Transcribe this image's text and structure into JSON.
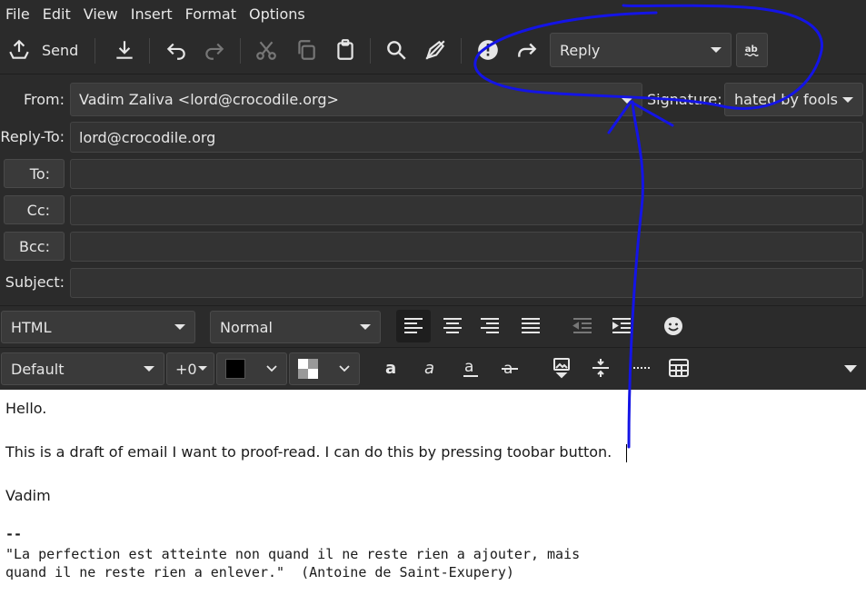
{
  "menu": [
    "File",
    "Edit",
    "View",
    "Insert",
    "Format",
    "Options"
  ],
  "toolbar": {
    "send_label": "Send",
    "reply_select": "Reply",
    "icons": [
      "send-icon",
      "save-download-icon",
      "undo-icon",
      "redo-icon",
      "cut-icon",
      "copy-icon",
      "paste-icon",
      "search-icon",
      "spellcheck-icon",
      "important-icon",
      "forward-icon",
      "spelling-ab-icon"
    ]
  },
  "header": {
    "from_label": "From:",
    "from_value": "Vadim Zaliva <lord@crocodile.org>",
    "signature_label": "Signature:",
    "signature_value": "hated by fools",
    "replyto_label": "Reply-To:",
    "replyto_value": "lord@crocodile.org",
    "to_label": "To:",
    "cc_label": "Cc:",
    "bcc_label": "Bcc:",
    "subject_label": "Subject:"
  },
  "format": {
    "mode": "HTML",
    "paragraph": "Normal",
    "font": "Default",
    "size": "+0",
    "text_color": "#000000"
  },
  "body": {
    "line1": "Hello.",
    "line2": "This is a draft of email I want to proof-read. I can do this by pressing toobar button.",
    "line3": "Vadim",
    "sig_sep": "--",
    "quote1": "\"La perfection est atteinte non quand il ne reste rien a ajouter, mais",
    "quote2": "quand il ne reste rien a enlever.\"  (Antoine de Saint-Exupery)"
  },
  "colors": {
    "background": "#2b2b2b",
    "annotation": "#1010e0"
  }
}
